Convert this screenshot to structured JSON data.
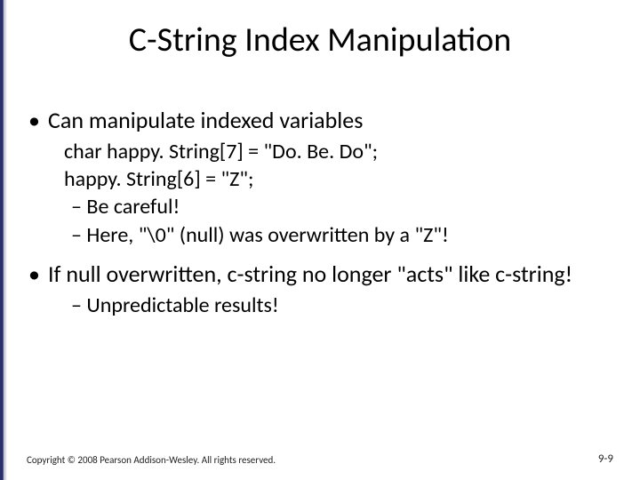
{
  "title": "C-String Index Manipulation",
  "bullets": {
    "b1": {
      "text": "Can manipulate indexed variables",
      "code1": "char happy. String[7] = \"Do. Be. Do\";",
      "code2": "happy. String[6] = \"Z\";",
      "d1": "Be careful!",
      "d2": "Here, \"\\0\" (null) was overwritten by a \"Z\"!"
    },
    "b2": {
      "text": "If null overwritten, c-string no longer \"acts\" like c-string!",
      "d1": "Unpredictable results!"
    }
  },
  "footer": {
    "copyright": "Copyright © 2008 Pearson Addison-Wesley. All rights reserved.",
    "page": "9-9"
  }
}
